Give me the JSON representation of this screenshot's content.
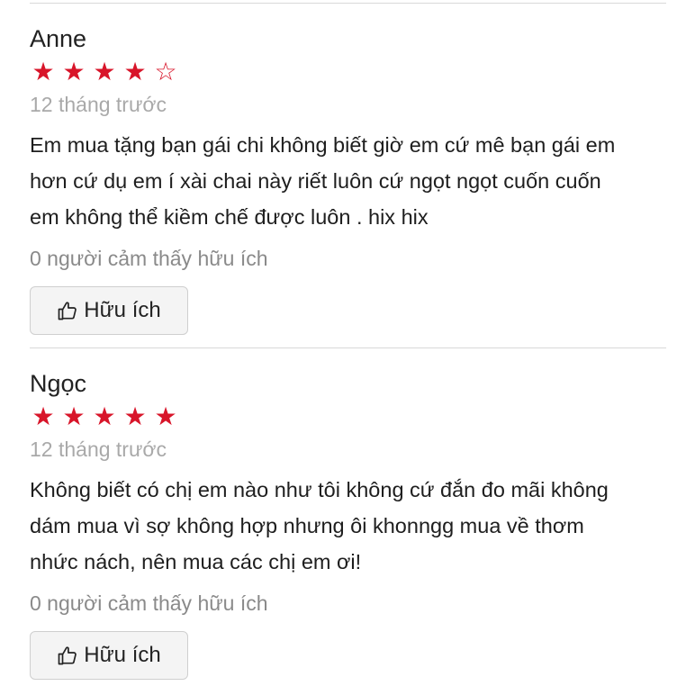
{
  "reviews": [
    {
      "author": "Anne",
      "rating": 4,
      "max_rating": 5,
      "date": "12 tháng trước",
      "lines": [
        "Em mua tặng bạn gái chi không biết giờ em cứ mê bạn gái em",
        "hơn cứ dụ em í xài chai này riết luôn cứ ngọt ngọt cuốn cuốn",
        "em không thể kiềm chế được luôn . hix hix"
      ],
      "helpful_count_text": "0 người cảm thấy hữu ích",
      "helpful_button": "Hữu ích"
    },
    {
      "author": "Ngọc",
      "rating": 5,
      "max_rating": 5,
      "date": "12 tháng trước",
      "lines": [
        "Không biết có chị em nào như tôi không cứ đắn đo mãi không",
        "dám mua vì sợ không hợp nhưng ôi khonngg mua về thơm",
        "nhức nách, nên mua các chị em ơi!"
      ],
      "helpful_count_text": "0 người cảm thấy hữu ích",
      "helpful_button": "Hữu ích"
    }
  ],
  "colors": {
    "star": "#d8152a",
    "muted": "#a9a9a9",
    "divider": "#d9d9d9"
  },
  "icons": {
    "star_filled": "★",
    "star_empty": "☆",
    "helpful": "thumbs-up-icon"
  }
}
